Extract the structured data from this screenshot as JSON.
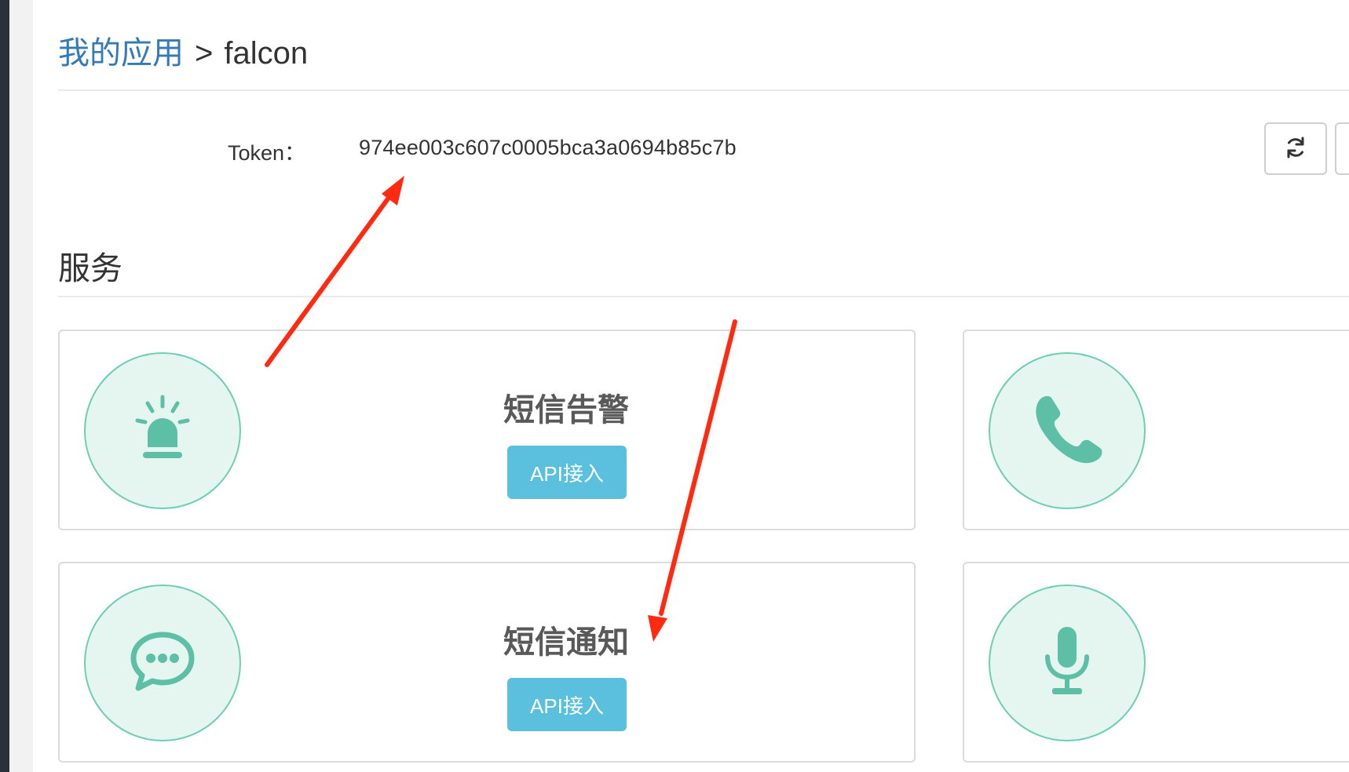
{
  "breadcrumb": {
    "link_label": "我的应用",
    "separator": ">",
    "current": "falcon"
  },
  "token": {
    "label": "Token：",
    "value": "974ee003c607c0005bca3a0694b85c7b"
  },
  "toolbar": {
    "refresh_icon": "refresh-icon"
  },
  "services": {
    "title": "服务",
    "items": [
      {
        "name": "短信告警",
        "icon": "siren-icon",
        "button_label": "API接入"
      },
      {
        "name": "",
        "icon": "phone-icon",
        "button_label": ""
      },
      {
        "name": "短信通知",
        "icon": "chat-bubble-icon",
        "button_label": "API接入"
      },
      {
        "name": "",
        "icon": "microphone-icon",
        "button_label": ""
      }
    ]
  },
  "colors": {
    "link": "#337ab7",
    "accent_teal": "#5dbfa6",
    "circle_fill": "#e5f5f0",
    "circle_border": "#6ccfb1",
    "api_button": "#5bc0de",
    "annotation_arrow": "#ff2a10"
  }
}
